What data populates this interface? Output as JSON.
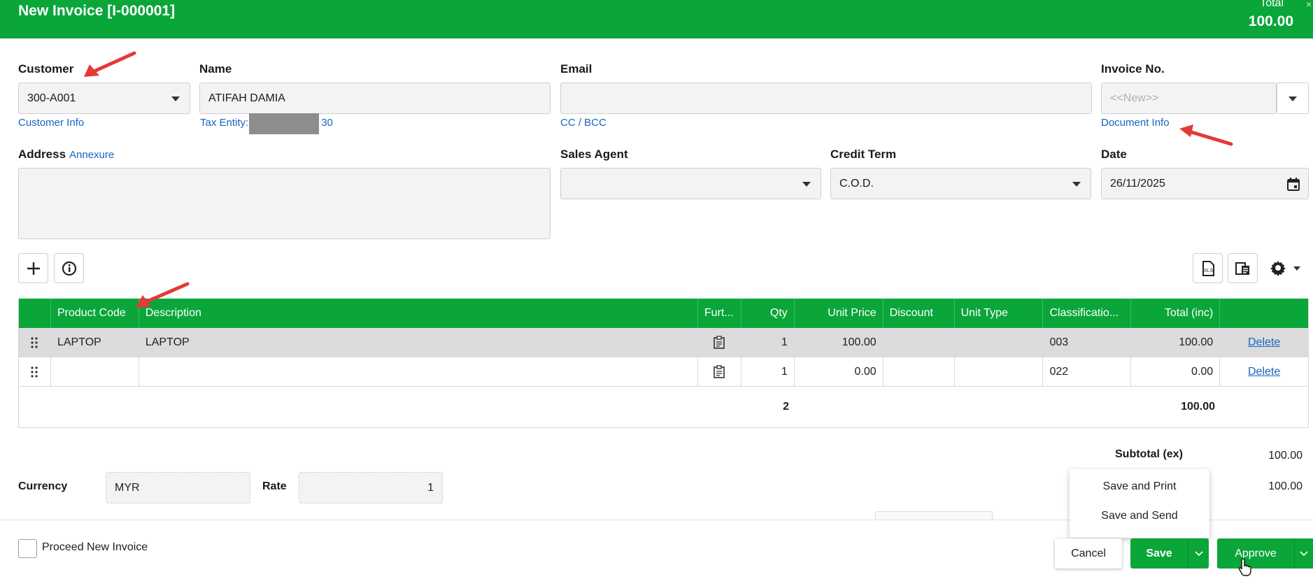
{
  "header": {
    "title": "New Invoice [I-000001]",
    "total_label": "Total",
    "total_value": "100.00"
  },
  "customer": {
    "label": "Customer",
    "value": "300-A001",
    "info_link": "Customer Info"
  },
  "name": {
    "label": "Name",
    "value": "ATIFAH DAMIA",
    "tax_entity_prefix": "Tax Entity:",
    "tax_entity_suffix": "30"
  },
  "email": {
    "label": "Email",
    "value": "",
    "cc_link": "CC / BCC"
  },
  "invoice_no": {
    "label": "Invoice No.",
    "placeholder": "<<New>>",
    "doc_link": "Document Info"
  },
  "address": {
    "label": "Address",
    "annexure_link": "Annexure",
    "value": ""
  },
  "sales_agent": {
    "label": "Sales Agent",
    "value": ""
  },
  "credit_term": {
    "label": "Credit Term",
    "value": "C.O.D."
  },
  "date": {
    "label": "Date",
    "value": "26/11/2025"
  },
  "table": {
    "columns": [
      "",
      "Product Code",
      "Description",
      "Furt...",
      "Qty",
      "Unit Price",
      "Discount",
      "Unit Type",
      "Classificatio...",
      "Total (inc)",
      ""
    ],
    "rows": [
      {
        "product_code": "LAPTOP",
        "description": "LAPTOP",
        "qty": "1",
        "unit_price": "100.00",
        "discount": "",
        "unit_type": "",
        "classification": "003",
        "total": "100.00",
        "action": "Delete"
      },
      {
        "product_code": "",
        "description": "",
        "qty": "1",
        "unit_price": "0.00",
        "discount": "",
        "unit_type": "",
        "classification": "022",
        "total": "0.00",
        "action": "Delete"
      }
    ],
    "summary": {
      "qty": "2",
      "total": "100.00"
    }
  },
  "totals": {
    "subtotal_label": "Subtotal (ex)",
    "subtotal_value": "100.00",
    "second_value": "100.00"
  },
  "currency": {
    "label": "Currency",
    "value": "MYR",
    "rate_label": "Rate",
    "rate_value": "1"
  },
  "save_menu": {
    "items": [
      "Save and Print",
      "Save and Send"
    ]
  },
  "footer": {
    "proceed_label": "Proceed New Invoice",
    "cancel": "Cancel",
    "save": "Save",
    "approve": "Approve"
  },
  "colors": {
    "primary": "#0aa63a",
    "link": "#1565c0",
    "annotation": "#e53935"
  }
}
